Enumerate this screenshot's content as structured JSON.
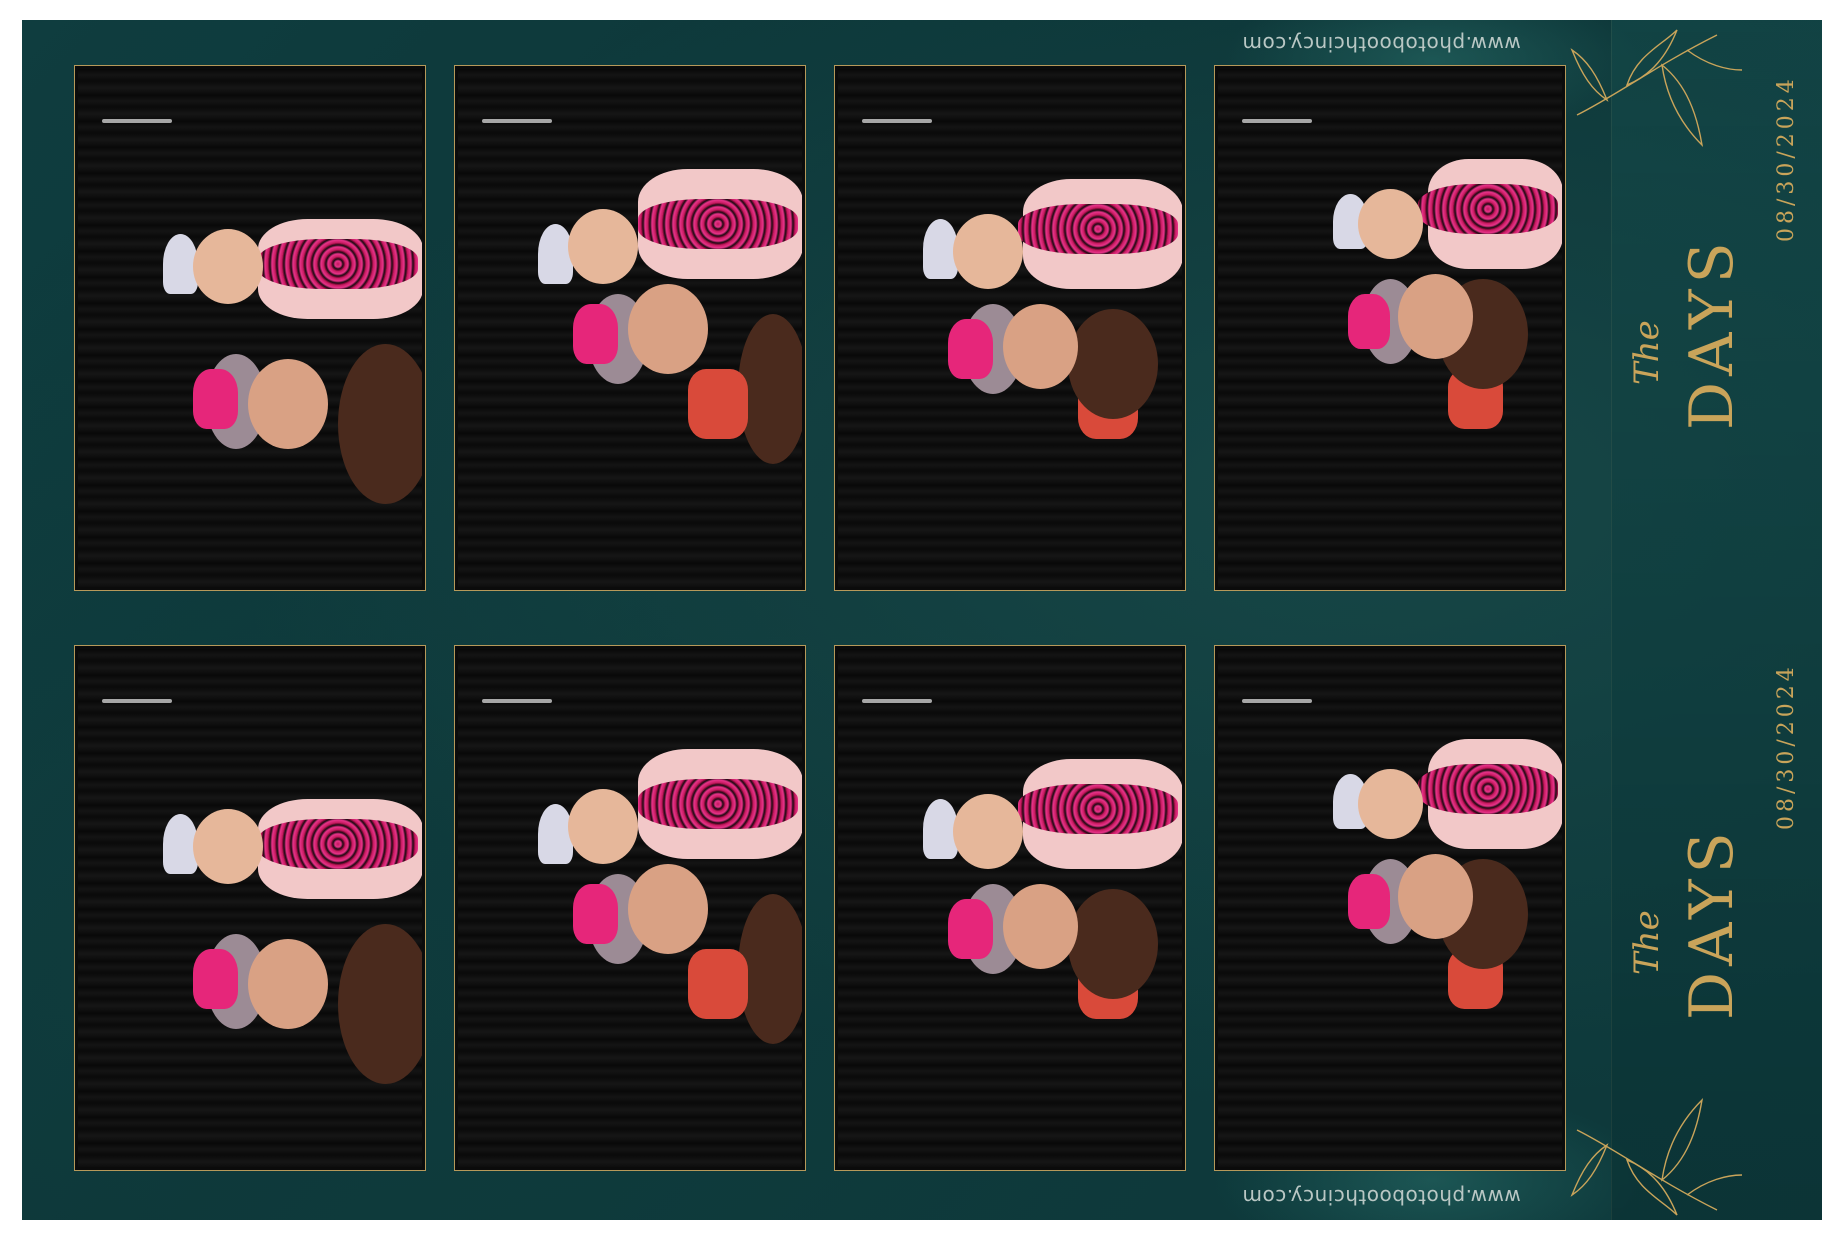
{
  "sheet": {
    "watermark": "www.photoboothcincy.com",
    "title_the": "The",
    "title_days": "DAYS",
    "date": "08/30/2024"
  },
  "colors": {
    "background": "#0f3d3f",
    "gold": "#c9a45a",
    "frame_border": "#b6995a"
  },
  "photos": {
    "count": 8,
    "subjects": "woman in pink hat and child with tiara and pink lei against black backdrop"
  }
}
